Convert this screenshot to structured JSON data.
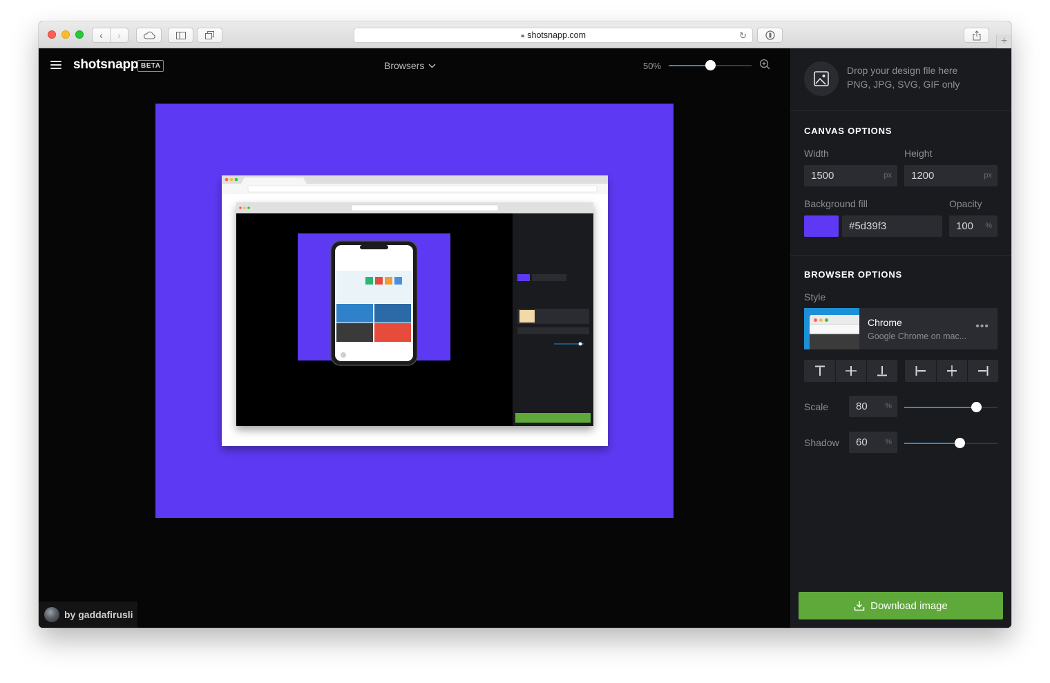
{
  "browser": {
    "url": "shotsnapp.com",
    "lock_icon": "lock-icon",
    "new_tab_label": "+"
  },
  "header": {
    "logo": "shotsnapp",
    "badge": "BETA",
    "mode_select": "Browsers",
    "zoom_label": "50%",
    "zoom_value": 50,
    "accent_color": "#1f90d6"
  },
  "canvas": {
    "background": "#5d39f3"
  },
  "credit": {
    "text": "by gaddafirusli"
  },
  "sidebar": {
    "drop_line1": "Drop your design file here",
    "drop_line2": "PNG, JPG, SVG, GIF only",
    "canvas_options": {
      "title": "CANVAS OPTIONS",
      "width_label": "Width",
      "width_value": "1500",
      "width_unit": "px",
      "height_label": "Height",
      "height_value": "1200",
      "height_unit": "px",
      "bg_label": "Background fill",
      "bg_value": "#5d39f3",
      "opacity_label": "Opacity",
      "opacity_value": "100",
      "opacity_unit": "%"
    },
    "browser_options": {
      "title": "BROWSER OPTIONS",
      "style_label": "Style",
      "style_name": "Chrome",
      "style_desc": "Google Chrome on mac...",
      "more_label": "•••",
      "scale_label": "Scale",
      "scale_value": "80",
      "scale_unit": "%",
      "scale_fraction": 0.77,
      "shadow_label": "Shadow",
      "shadow_value": "60",
      "shadow_unit": "%",
      "shadow_fraction": 0.59
    },
    "download_label": "Download image",
    "download_color": "#5ea93a"
  }
}
